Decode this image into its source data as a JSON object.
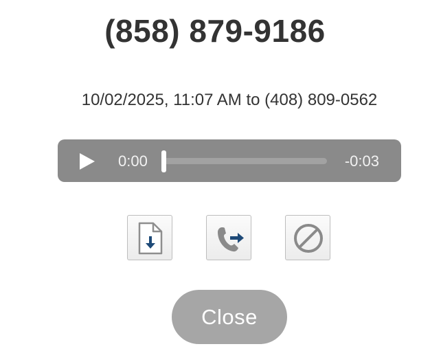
{
  "header": {
    "caller_number": "(858) 879-9186"
  },
  "call": {
    "details": "10/02/2025, 11:07 AM to (408) 809-0562"
  },
  "player": {
    "current_time": "0:00",
    "remaining_time": "-0:03",
    "progress": 0,
    "state": "paused",
    "play_icon": "play-icon"
  },
  "actions": [
    {
      "name": "download",
      "icon": "file-download-icon"
    },
    {
      "name": "forward",
      "icon": "phone-forward-icon",
      "accent": "#1e4a78"
    },
    {
      "name": "block",
      "icon": "block-icon"
    }
  ],
  "footer": {
    "close_label": "Close"
  }
}
